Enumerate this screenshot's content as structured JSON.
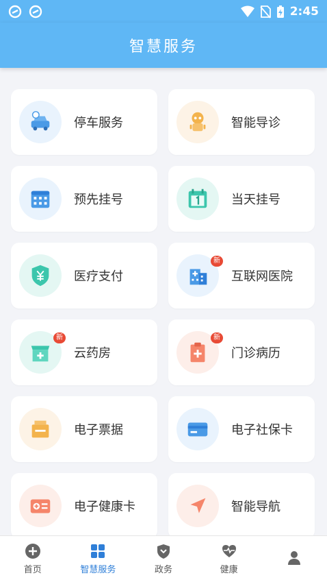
{
  "status": {
    "time": "2:45"
  },
  "header": {
    "title": "智慧服务"
  },
  "services": [
    {
      "label": "停车服务",
      "icon": "car-icon",
      "badge": ""
    },
    {
      "label": "智能导诊",
      "icon": "robot-icon",
      "badge": ""
    },
    {
      "label": "预先挂号",
      "icon": "calendar-icon",
      "badge": ""
    },
    {
      "label": "当天挂号",
      "icon": "calendar-today-icon",
      "badge": ""
    },
    {
      "label": "医疗支付",
      "icon": "yuan-shield-icon",
      "badge": ""
    },
    {
      "label": "互联网医院",
      "icon": "hospital-building-icon",
      "badge": "新"
    },
    {
      "label": "云药房",
      "icon": "pharmacy-icon",
      "badge": "新"
    },
    {
      "label": "门诊病历",
      "icon": "medical-record-icon",
      "badge": "新"
    },
    {
      "label": "电子票据",
      "icon": "receipt-icon",
      "badge": ""
    },
    {
      "label": "电子社保卡",
      "icon": "social-security-card-icon",
      "badge": ""
    },
    {
      "label": "电子健康卡",
      "icon": "health-card-icon",
      "badge": ""
    },
    {
      "label": "智能导航",
      "icon": "navigation-arrow-icon",
      "badge": ""
    }
  ],
  "nav": [
    {
      "label": "首页",
      "icon": "plus-circle-icon"
    },
    {
      "label": "智慧服务",
      "icon": "grid-icon"
    },
    {
      "label": "政务",
      "icon": "emblem-icon"
    },
    {
      "label": "健康",
      "icon": "heartbeat-icon"
    }
  ],
  "colors": {
    "primary": "#5fb7f5",
    "active_tab": "#2f7fd8"
  }
}
